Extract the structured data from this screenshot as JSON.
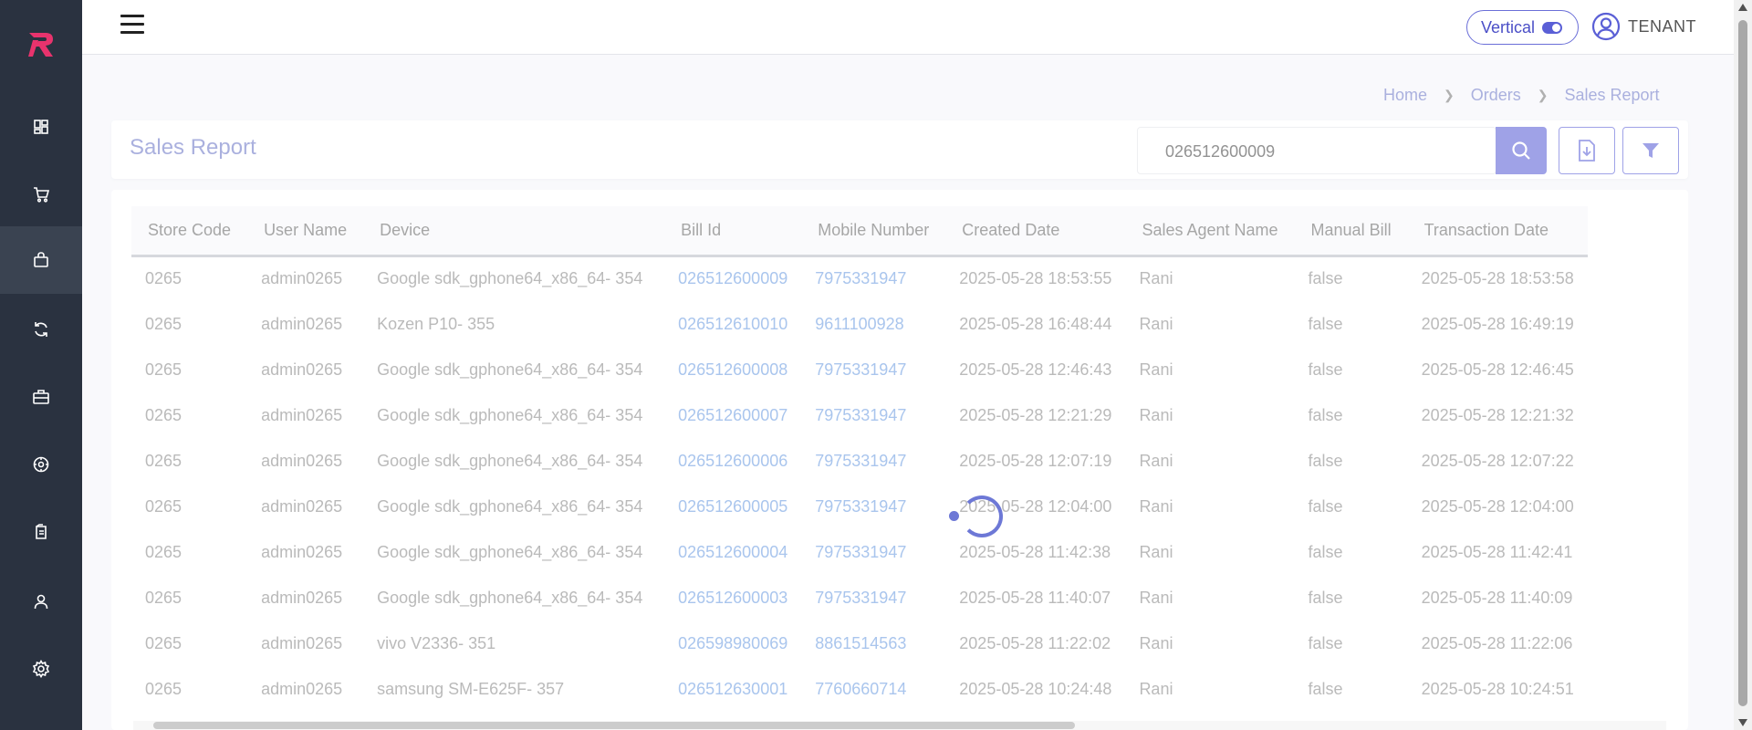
{
  "header": {
    "layout_toggle_label": "Vertical",
    "user_label": "TENANT"
  },
  "breadcrumb": [
    "Home",
    "Orders",
    "Sales Report"
  ],
  "page": {
    "title": "Sales Report",
    "search_value": "026512600009"
  },
  "sidebar": {
    "items": [
      {
        "icon": "dashboard-icon"
      },
      {
        "icon": "cart-icon"
      },
      {
        "icon": "shopping-bag-icon",
        "active": true
      },
      {
        "icon": "refresh-icon"
      },
      {
        "icon": "briefcase-icon"
      },
      {
        "icon": "settings-circle-icon"
      },
      {
        "icon": "clipboard-icon"
      },
      {
        "icon": "user-icon"
      },
      {
        "icon": "gear-icon"
      }
    ]
  },
  "table": {
    "columns": [
      "Store Code",
      "User Name",
      "Device",
      "Bill Id",
      "Mobile Number",
      "Created Date",
      "Sales Agent Name",
      "Manual Bill",
      "Transaction Date"
    ],
    "rows": [
      [
        "0265",
        "admin0265",
        "Google sdk_gphone64_x86_64- 354",
        "026512600009",
        "7975331947",
        "2025-05-28 18:53:55",
        "Rani",
        "false",
        "2025-05-28 18:53:58"
      ],
      [
        "0265",
        "admin0265",
        "Kozen P10- 355",
        "026512610010",
        "9611100928",
        "2025-05-28 16:48:44",
        "Rani",
        "false",
        "2025-05-28 16:49:19"
      ],
      [
        "0265",
        "admin0265",
        "Google sdk_gphone64_x86_64- 354",
        "026512600008",
        "7975331947",
        "2025-05-28 12:46:43",
        "Rani",
        "false",
        "2025-05-28 12:46:45"
      ],
      [
        "0265",
        "admin0265",
        "Google sdk_gphone64_x86_64- 354",
        "026512600007",
        "7975331947",
        "2025-05-28 12:21:29",
        "Rani",
        "false",
        "2025-05-28 12:21:32"
      ],
      [
        "0265",
        "admin0265",
        "Google sdk_gphone64_x86_64- 354",
        "026512600006",
        "7975331947",
        "2025-05-28 12:07:19",
        "Rani",
        "false",
        "2025-05-28 12:07:22"
      ],
      [
        "0265",
        "admin0265",
        "Google sdk_gphone64_x86_64- 354",
        "026512600005",
        "7975331947",
        "2025-05-28 12:04:00",
        "Rani",
        "false",
        "2025-05-28 12:04:00"
      ],
      [
        "0265",
        "admin0265",
        "Google sdk_gphone64_x86_64- 354",
        "026512600004",
        "7975331947",
        "2025-05-28 11:42:38",
        "Rani",
        "false",
        "2025-05-28 11:42:41"
      ],
      [
        "0265",
        "admin0265",
        "Google sdk_gphone64_x86_64- 354",
        "026512600003",
        "7975331947",
        "2025-05-28 11:40:07",
        "Rani",
        "false",
        "2025-05-28 11:40:09"
      ],
      [
        "0265",
        "admin0265",
        "vivo V2336- 351",
        "026598980069",
        "8861514563",
        "2025-05-28 11:22:02",
        "Rani",
        "false",
        "2025-05-28 11:22:06"
      ],
      [
        "0265",
        "admin0265",
        "samsung SM-E625F- 357",
        "026512630001",
        "7760660714",
        "2025-05-28 10:24:48",
        "Rani",
        "false",
        "2025-05-28 10:24:51"
      ]
    ]
  },
  "colors": {
    "accent": "#5a5fd6",
    "sidebar_bg": "#2a3240",
    "link": "#6b9be0",
    "brand": "#e8336d"
  }
}
